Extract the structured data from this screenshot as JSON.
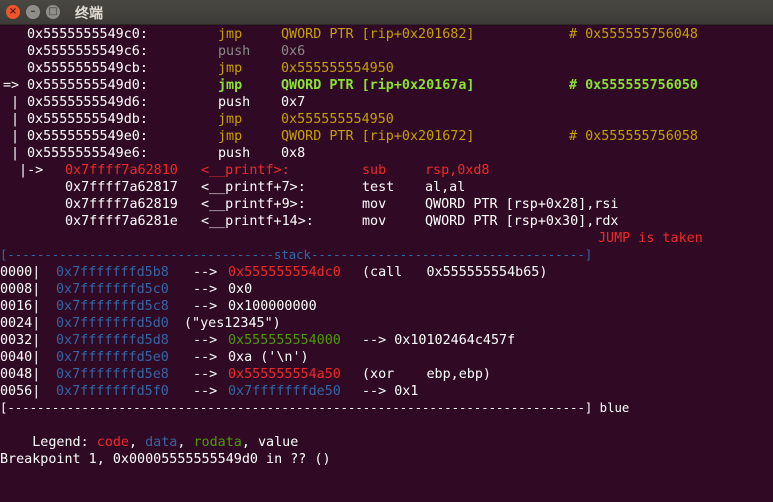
{
  "window": {
    "title": "终端",
    "buttons": {
      "close": "×",
      "minimize": "–",
      "maximize": "□"
    }
  },
  "colors": {
    "background": "#300a24",
    "code": "#ef2929",
    "data": "#3465a4",
    "rodata": "#4e9a06",
    "jump_instruction": "#c4a000",
    "current_instruction": "#8ae234"
  },
  "disasm": [
    {
      "prefix": "   ",
      "addr": "0x5555555549c0:",
      "op": "jmp",
      "args": "QWORD PTR [rip+0x201682]",
      "comment": "# 0x555555756048"
    },
    {
      "prefix": "   ",
      "addr": "0x5555555549c6:",
      "op": "push",
      "args": "0x6",
      "comment": ""
    },
    {
      "prefix": "   ",
      "addr": "0x5555555549cb:",
      "op": "jmp",
      "args": "0x555555554950",
      "comment": ""
    },
    {
      "prefix": "=> ",
      "addr": "0x5555555549d0:",
      "op": "jmp",
      "args": "QWORD PTR [rip+0x20167a]",
      "comment": "# 0x555555756050"
    },
    {
      "prefix": " | ",
      "addr": "0x5555555549d6:",
      "op": "push",
      "args": "0x7",
      "comment": ""
    },
    {
      "prefix": " | ",
      "addr": "0x5555555549db:",
      "op": "jmp",
      "args": "0x555555554950",
      "comment": ""
    },
    {
      "prefix": " | ",
      "addr": "0x5555555549e0:",
      "op": "jmp",
      "args": "QWORD PTR [rip+0x201672]",
      "comment": "# 0x555555756058"
    },
    {
      "prefix": " | ",
      "addr": "0x5555555549e6:",
      "op": "push",
      "args": "0x8",
      "comment": ""
    }
  ],
  "target": [
    {
      "prefix": " |->",
      "addr": "0x7ffff7a62810",
      "sym": "<__printf>:",
      "op": "sub",
      "args": "rsp,0xd8"
    },
    {
      "prefix": "",
      "addr": "0x7ffff7a62817",
      "sym": "<__printf+7>:",
      "op": "test",
      "args": "al,al"
    },
    {
      "prefix": "",
      "addr": "0x7ffff7a62819",
      "sym": "<__printf+9>:",
      "op": "mov",
      "args": "QWORD PTR [rsp+0x28],rsi"
    },
    {
      "prefix": "",
      "addr": "0x7ffff7a6281e",
      "sym": "<__printf+14>:",
      "op": "mov",
      "args": "QWORD PTR [rsp+0x30],rdx"
    }
  ],
  "jump_status": "JUMP is taken",
  "stack_header": "[------------------------------------stack-------------------------------------]",
  "stack": [
    {
      "off": "0000|",
      "addr": "0x7fffffffd5b8",
      "arrow": "-->",
      "val": "0x555555554dc0",
      "rest": "(call   0x555555554b65)"
    },
    {
      "off": "0008|",
      "addr": "0x7fffffffd5c0",
      "arrow": "-->",
      "val": "0x0",
      "rest": ""
    },
    {
      "off": "0016|",
      "addr": "0x7fffffffd5c8",
      "arrow": "-->",
      "val": "0x100000000",
      "rest": ""
    },
    {
      "off": "0024|",
      "addr": "0x7fffffffd5d0",
      "arrow": "",
      "val": "(\"yes12345\")",
      "rest": ""
    },
    {
      "off": "0032|",
      "addr": "0x7fffffffd5d8",
      "arrow": "-->",
      "val": "0x555555554000",
      "rest": "--> 0x10102464c457f"
    },
    {
      "off": "0040|",
      "addr": "0x7fffffffd5e0",
      "arrow": "-->",
      "val": "0xa ('\\n')",
      "rest": ""
    },
    {
      "off": "0048|",
      "addr": "0x7fffffffd5e8",
      "arrow": "-->",
      "val": "0x555555554a50",
      "rest": "(xor    ebp,ebp)"
    },
    {
      "off": "0056|",
      "addr": "0x7fffffffd5f0",
      "arrow": "-->",
      "val": "0x7fffffffde50",
      "rest": "--> 0x1"
    }
  ],
  "stack_footer": "[------------------------------------------------------------------------------] blue",
  "legend": {
    "label": "Legend: ",
    "code": "code",
    "sep1": ", ",
    "data": "data",
    "sep2": ", ",
    "rodata": "rodata",
    "sep3": ", ",
    "value": "value"
  },
  "breakpoint": "Breakpoint 1, 0x00005555555549d0 in ?? ()"
}
